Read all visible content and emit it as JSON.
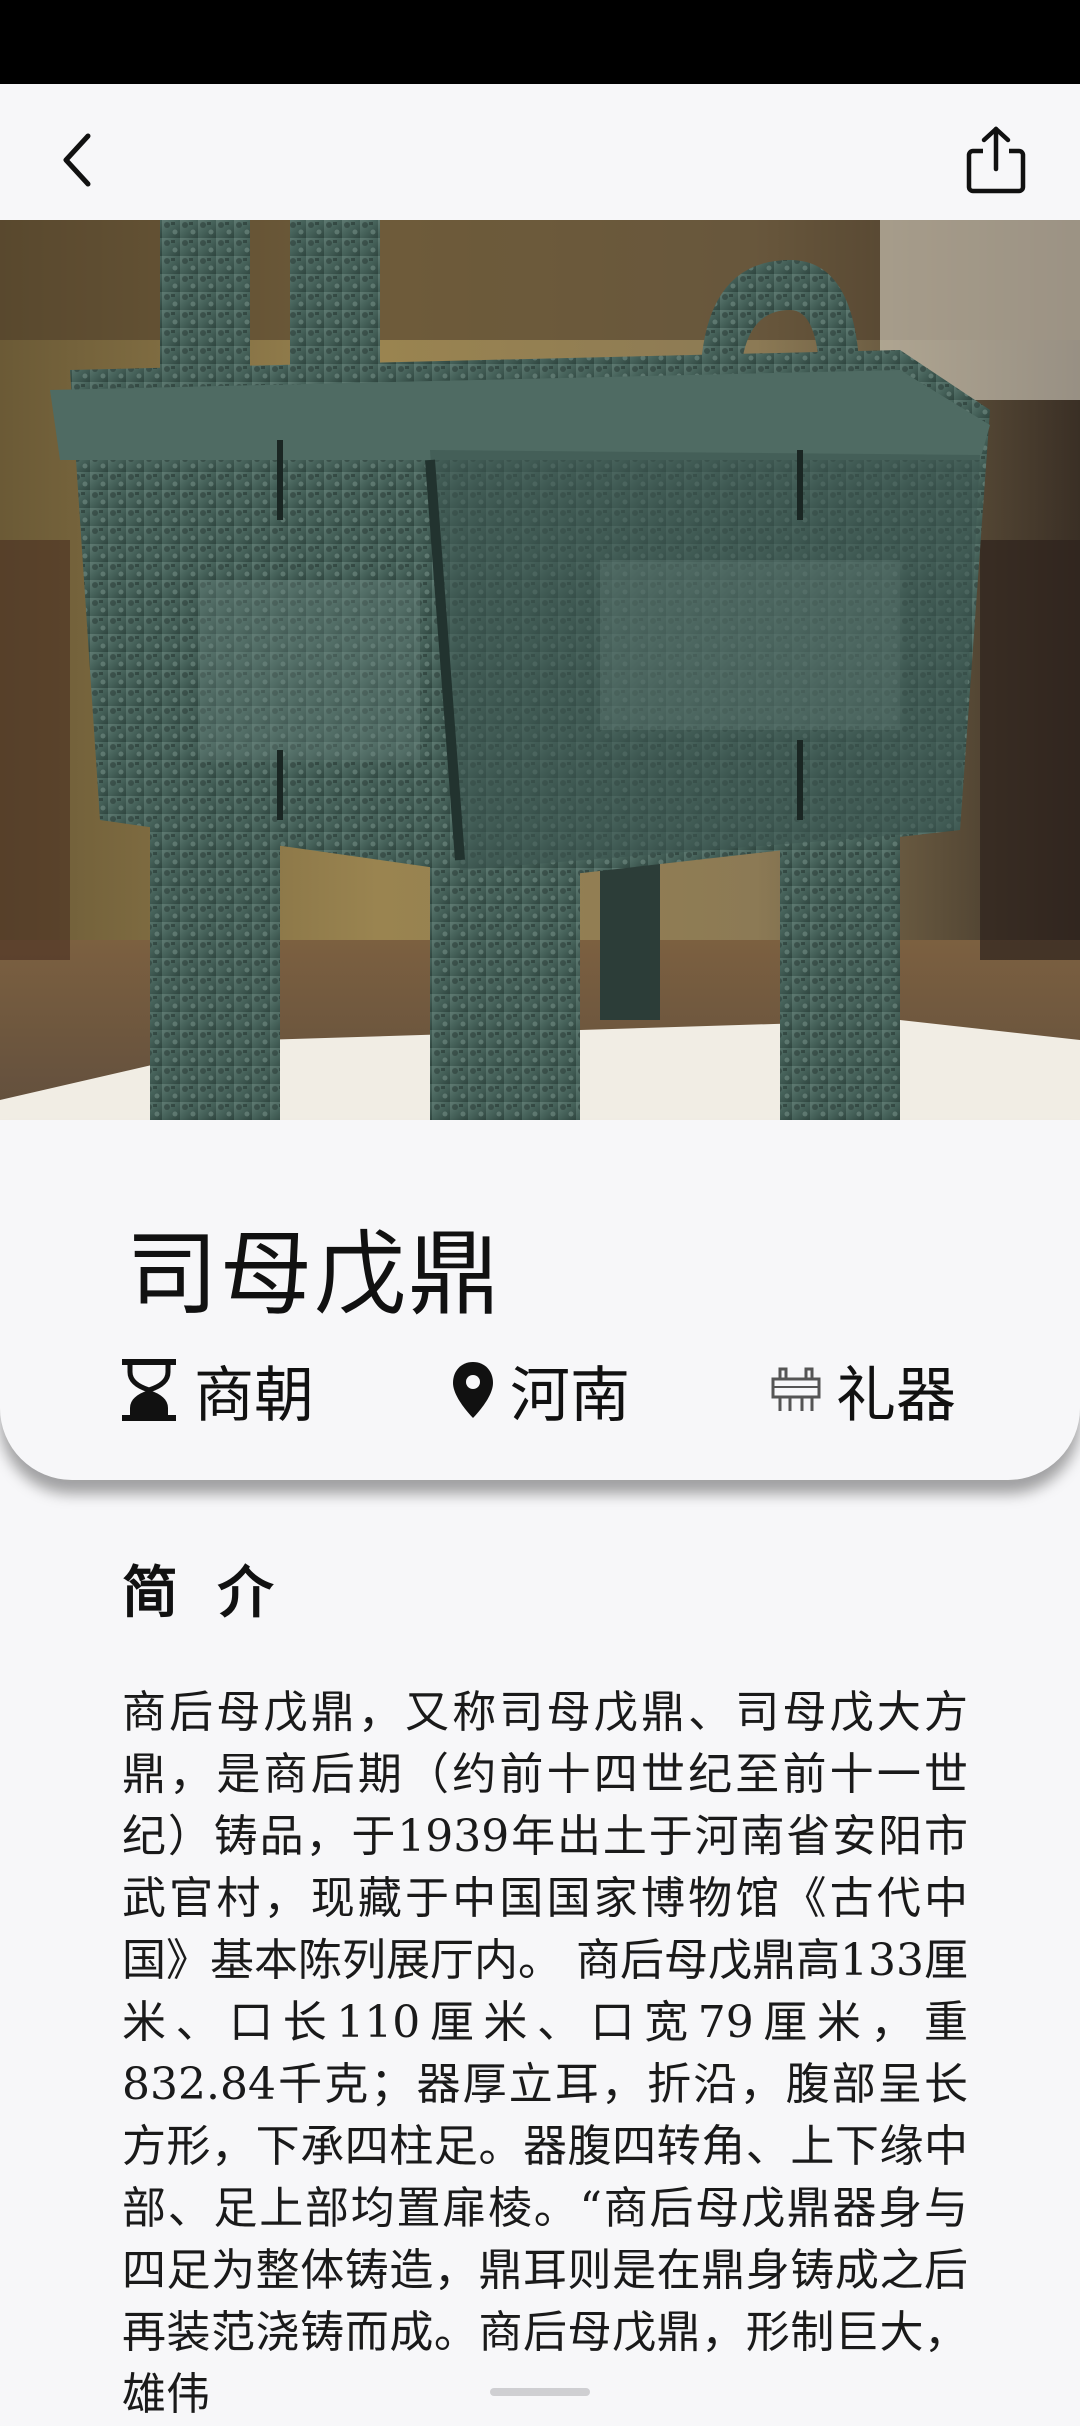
{
  "status_bar": {},
  "toolbar": {
    "back_icon": "chevron-left-icon",
    "share_icon": "share-icon"
  },
  "artifact": {
    "title": "司母戊鼎",
    "era": "商朝",
    "era_icon": "hourglass-icon",
    "location": "河南",
    "location_icon": "map-pin-icon",
    "category": "礼器",
    "category_icon": "ding-vessel-icon"
  },
  "intro": {
    "heading": "简 介",
    "text": "商后母戊鼎，又称司母戊鼎、司母戊大方鼎，是商后期（约前十四世纪至前十一世纪）铸品，于1939年出土于河南省安阳市武官村，现藏于中国国家博物馆《古代中国》基本陈列展厅内。 商后母戊鼎高133厘米、口长110厘米、口宽79厘米，重832.84千克；器厚立耳，折沿，腹部呈长方形，下承四柱足。器腹四转角、上下缘中部、足上部均置扉棱。“商后母戊鼎器身与四足为整体铸造，鼎耳则是在鼎身铸成之后再装范浇铸而成。商后母戊鼎，形制巨大，雄伟"
  },
  "colors": {
    "background": "#f7f7f9",
    "status_bar": "#000000",
    "bronze": "#3f5a55"
  }
}
